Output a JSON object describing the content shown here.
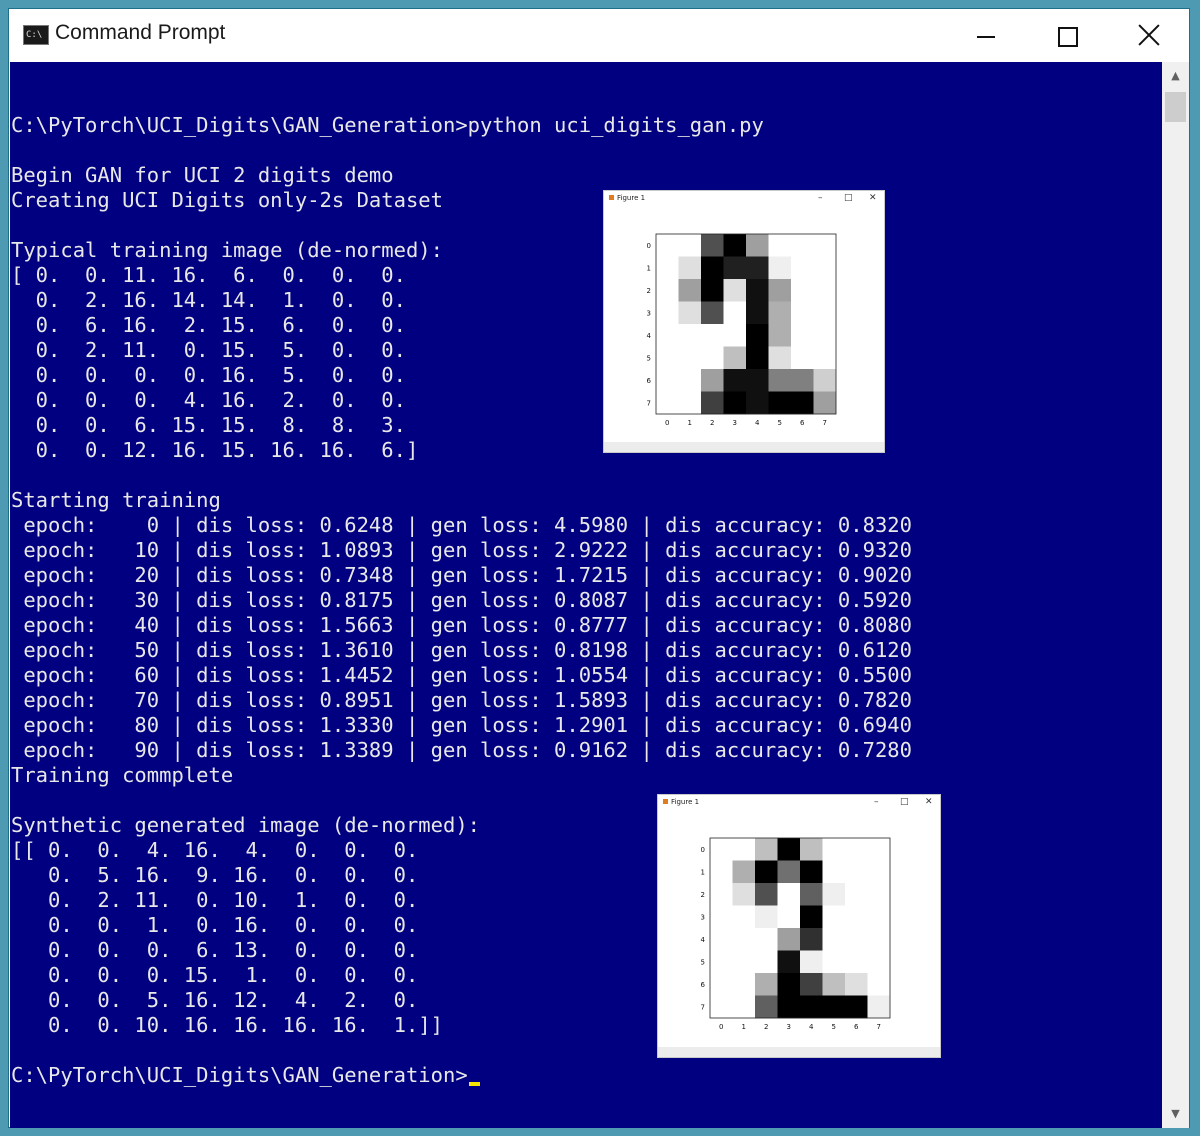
{
  "window": {
    "title": "Command Prompt",
    "icon": "console-icon"
  },
  "console": {
    "lines": [
      "",
      "C:\\PyTorch\\UCI_Digits\\GAN_Generation>python uci_digits_gan.py",
      "",
      "Begin GAN for UCI 2 digits demo",
      "Creating UCI Digits only-2s Dataset",
      "",
      "Typical training image (de-normed):",
      "[ 0.  0. 11. 16.  6.  0.  0.  0.",
      "  0.  2. 16. 14. 14.  1.  0.  0.",
      "  0.  6. 16.  2. 15.  6.  0.  0.",
      "  0.  2. 11.  0. 15.  5.  0.  0.",
      "  0.  0.  0.  0. 16.  5.  0.  0.",
      "  0.  0.  0.  4. 16.  2.  0.  0.",
      "  0.  0.  6. 15. 15.  8.  8.  3.",
      "  0.  0. 12. 16. 15. 16. 16.  6.]",
      "",
      "Starting training",
      " epoch:    0 | dis loss: 0.6248 | gen loss: 4.5980 | dis accuracy: 0.8320",
      " epoch:   10 | dis loss: 1.0893 | gen loss: 2.9222 | dis accuracy: 0.9320",
      " epoch:   20 | dis loss: 0.7348 | gen loss: 1.7215 | dis accuracy: 0.9020",
      " epoch:   30 | dis loss: 0.8175 | gen loss: 0.8087 | dis accuracy: 0.5920",
      " epoch:   40 | dis loss: 1.5663 | gen loss: 0.8777 | dis accuracy: 0.8080",
      " epoch:   50 | dis loss: 1.3610 | gen loss: 0.8198 | dis accuracy: 0.6120",
      " epoch:   60 | dis loss: 1.4452 | gen loss: 1.0554 | dis accuracy: 0.5500",
      " epoch:   70 | dis loss: 0.8951 | gen loss: 1.5893 | dis accuracy: 0.7820",
      " epoch:   80 | dis loss: 1.3330 | gen loss: 1.2901 | dis accuracy: 0.6940",
      " epoch:   90 | dis loss: 1.3389 | gen loss: 0.9162 | dis accuracy: 0.7280",
      "Training commplete",
      "",
      "Synthetic generated image (de-normed):",
      "[[ 0.  0.  4. 16.  4.  0.  0.  0.",
      "   0.  5. 16.  9. 16.  0.  0.  0.",
      "   0.  2. 11.  0. 10.  1.  0.  0.",
      "   0.  0.  1.  0. 16.  0.  0.  0.",
      "   0.  0.  0.  6. 13.  0.  0.  0.",
      "   0.  0.  0. 15.  1.  0.  0.  0.",
      "   0.  0.  5. 16. 12.  4.  2.  0.",
      "   0.  0. 10. 16. 16. 16. 16.  1.]]",
      ""
    ],
    "prompt": "C:\\PyTorch\\UCI_Digits\\GAN_Generation>",
    "background": "#000080",
    "foreground": "#e8e8e8",
    "cursor_color": "#f5e600"
  },
  "figures": [
    {
      "title": "Figure 1",
      "ticks": [
        "0",
        "1",
        "2",
        "3",
        "4",
        "5",
        "6",
        "7"
      ],
      "pixels": [
        [
          0,
          0,
          11,
          16,
          6,
          0,
          0,
          0
        ],
        [
          0,
          2,
          16,
          14,
          14,
          1,
          0,
          0
        ],
        [
          0,
          6,
          16,
          2,
          15,
          6,
          0,
          0
        ],
        [
          0,
          2,
          11,
          0,
          15,
          5,
          0,
          0
        ],
        [
          0,
          0,
          0,
          0,
          16,
          5,
          0,
          0
        ],
        [
          0,
          0,
          0,
          4,
          16,
          2,
          0,
          0
        ],
        [
          0,
          0,
          6,
          15,
          15,
          8,
          8,
          3
        ],
        [
          0,
          0,
          12,
          16,
          15,
          16,
          16,
          6
        ]
      ]
    },
    {
      "title": "Figure 1",
      "ticks": [
        "0",
        "1",
        "2",
        "3",
        "4",
        "5",
        "6",
        "7"
      ],
      "pixels": [
        [
          0,
          0,
          4,
          16,
          4,
          0,
          0,
          0
        ],
        [
          0,
          5,
          16,
          9,
          16,
          0,
          0,
          0
        ],
        [
          0,
          2,
          11,
          0,
          10,
          1,
          0,
          0
        ],
        [
          0,
          0,
          1,
          0,
          16,
          0,
          0,
          0
        ],
        [
          0,
          0,
          0,
          6,
          13,
          0,
          0,
          0
        ],
        [
          0,
          0,
          0,
          15,
          1,
          0,
          0,
          0
        ],
        [
          0,
          0,
          5,
          16,
          12,
          4,
          2,
          0
        ],
        [
          0,
          0,
          10,
          16,
          16,
          16,
          16,
          1
        ]
      ]
    }
  ]
}
